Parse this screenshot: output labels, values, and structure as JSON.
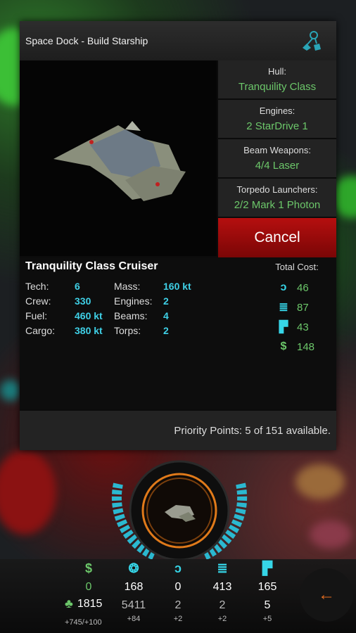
{
  "dialog": {
    "title": "Space Dock - Build Starship",
    "hull_label": "Hull:",
    "hull_value": "Tranquility Class",
    "engines_label": "Engines:",
    "engines_value": "2 StarDrive 1",
    "beams_label": "Beam Weapons:",
    "beams_value": "4/4 Laser",
    "torps_label": "Torpedo Launchers:",
    "torps_value": "2/2 Mark 1 Photon",
    "cancel_label": "Cancel"
  },
  "ship": {
    "name": "Tranquility Class Cruiser",
    "tech_label": "Tech:",
    "tech": "6",
    "crew_label": "Crew:",
    "crew": "330",
    "fuel_label": "Fuel:",
    "fuel": "460 kt",
    "cargo_label": "Cargo:",
    "cargo": "380 kt",
    "mass_label": "Mass:",
    "mass": "160 kt",
    "engines_label": "Engines:",
    "engines": "2",
    "beams_label": "Beams:",
    "beams": "4",
    "torps_label": "Torps:",
    "torps": "2"
  },
  "cost": {
    "title": "Total Cost:",
    "items": [
      {
        "icon": "duranium-icon",
        "value": "46"
      },
      {
        "icon": "tritanium-icon",
        "value": "87"
      },
      {
        "icon": "molybdenum-icon",
        "value": "43"
      },
      {
        "icon": "megacredits-icon",
        "value": "148"
      }
    ]
  },
  "priority_text": "Priority Points: 5 of 151 available.",
  "resources": {
    "money": {
      "icon": "$",
      "value": "0"
    },
    "supplies": {
      "value": "168",
      "sub": "5411",
      "tiny": "+84"
    },
    "duranium": {
      "value": "0",
      "sub": "2",
      "tiny": "+2"
    },
    "tritanium": {
      "value": "413",
      "sub": "2",
      "tiny": "+2"
    },
    "molybdenum": {
      "value": "165",
      "sub": "5",
      "tiny": "+5"
    },
    "colonists": {
      "value": "1815",
      "tiny": "+745/+100"
    }
  },
  "colors": {
    "accent_green": "#6cc76a",
    "accent_cyan": "#36d6e8",
    "cancel_red": "#b50f0f",
    "back_orange": "#e36c1f"
  }
}
